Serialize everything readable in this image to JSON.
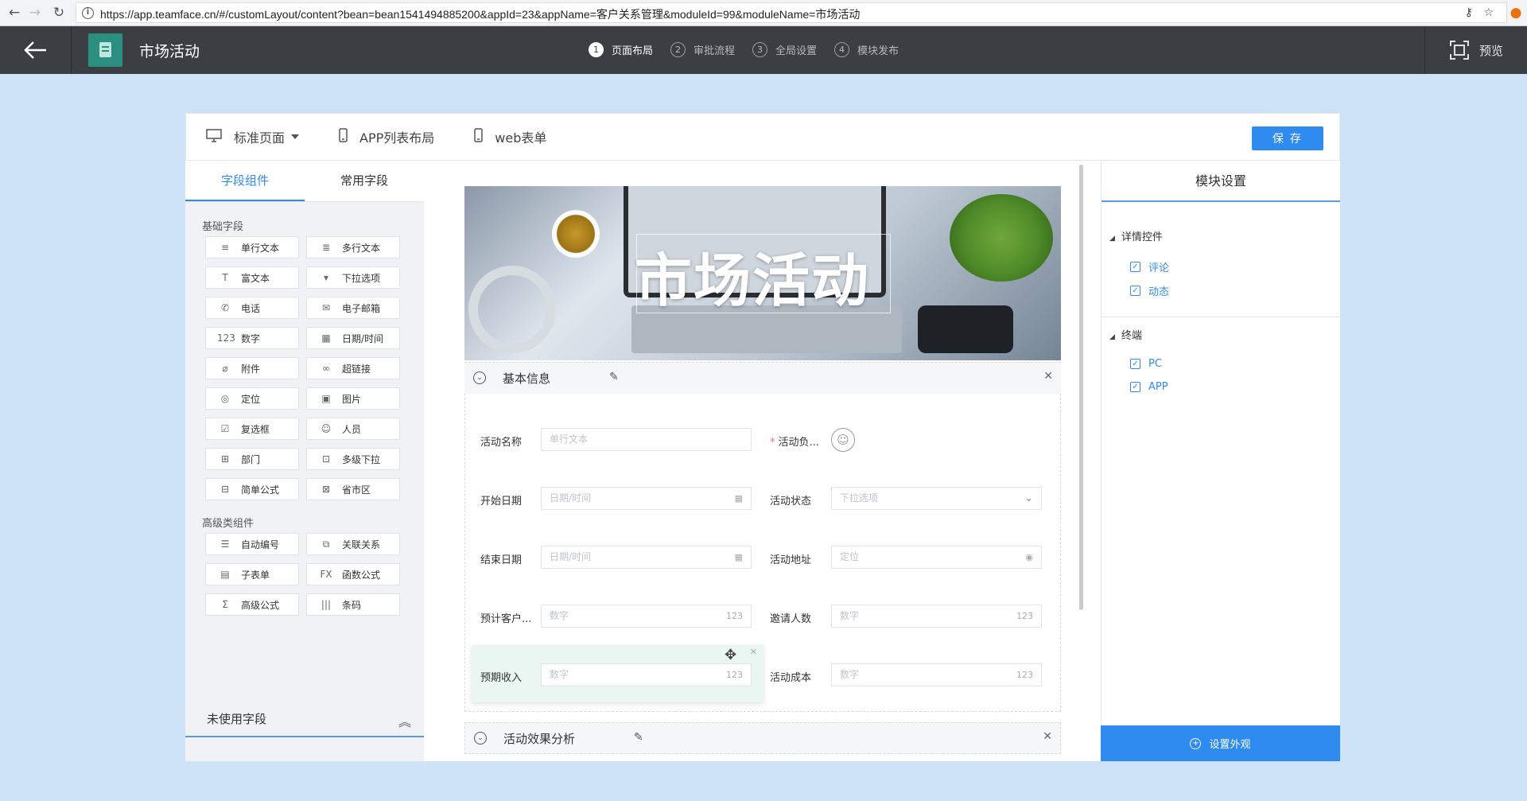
{
  "browser": {
    "url": "https://app.teamface.cn/#/customLayout/content?bean=bean1541494885200&appId=23&appName=客户关系管理&moduleId=99&moduleName=市场活动"
  },
  "header": {
    "module_title": "市场活动",
    "steps": [
      {
        "num": "1",
        "label": "页面布局"
      },
      {
        "num": "2",
        "label": "审批流程"
      },
      {
        "num": "3",
        "label": "全局设置"
      },
      {
        "num": "4",
        "label": "模块发布"
      }
    ],
    "preview_label": "预览"
  },
  "view_tabs": {
    "standard": "标准页面",
    "app_list": "APP列表布局",
    "web_form": "web表单",
    "save": "保 存"
  },
  "left_panel": {
    "tabs": [
      "字段组件",
      "常用字段"
    ],
    "basic_title": "基础字段",
    "basic_fields": [
      {
        "label": "单行文本",
        "icon": "≡"
      },
      {
        "label": "多行文本",
        "icon": "≣"
      },
      {
        "label": "富文本",
        "icon": "T"
      },
      {
        "label": "下拉选项",
        "icon": "▾"
      },
      {
        "label": "电话",
        "icon": "✆"
      },
      {
        "label": "电子邮箱",
        "icon": "✉"
      },
      {
        "label": "数字",
        "icon": "123"
      },
      {
        "label": "日期/时间",
        "icon": "▦"
      },
      {
        "label": "附件",
        "icon": "⌀"
      },
      {
        "label": "超链接",
        "icon": "∞"
      },
      {
        "label": "定位",
        "icon": "◎"
      },
      {
        "label": "图片",
        "icon": "▣"
      },
      {
        "label": "复选框",
        "icon": "☑"
      },
      {
        "label": "人员",
        "icon": "☺"
      },
      {
        "label": "部门",
        "icon": "⊞"
      },
      {
        "label": "多级下拉",
        "icon": "⊡"
      },
      {
        "label": "简单公式",
        "icon": "⊟"
      },
      {
        "label": "省市区",
        "icon": "⊠"
      }
    ],
    "advanced_title": "高级类组件",
    "advanced_fields": [
      {
        "label": "自动编号",
        "icon": "☰"
      },
      {
        "label": "关联关系",
        "icon": "⧉"
      },
      {
        "label": "子表单",
        "icon": "▤"
      },
      {
        "label": "函数公式",
        "icon": "FX"
      },
      {
        "label": "高级公式",
        "icon": "Σ"
      },
      {
        "label": "条码",
        "icon": "|||"
      }
    ],
    "unused_title": "未使用字段"
  },
  "canvas": {
    "banner_title": "市场活动",
    "section1": "基本信息",
    "section2": "活动效果分析",
    "fields": {
      "name_label": "活动名称",
      "name_placeholder": "单行文本",
      "owner_label": "活动负...",
      "start_label": "开始日期",
      "start_placeholder": "日期/时间",
      "status_label": "活动状态",
      "status_placeholder": "下拉选项",
      "end_label": "结束日期",
      "end_placeholder": "日期/时间",
      "address_label": "活动地址",
      "address_placeholder": "定位",
      "expected_customers_label": "预计客户...",
      "number_placeholder": "数字",
      "number_suffix": "123",
      "invite_label": "邀请人数",
      "revenue_label": "预期收入",
      "cost_label": "活动成本"
    }
  },
  "right_panel": {
    "title": "模块设置",
    "group1": "详情控件",
    "group1_items": [
      "评论",
      "动态"
    ],
    "group2": "终端",
    "group2_items": [
      "PC",
      "APP"
    ],
    "appearance_button": "设置外观"
  }
}
